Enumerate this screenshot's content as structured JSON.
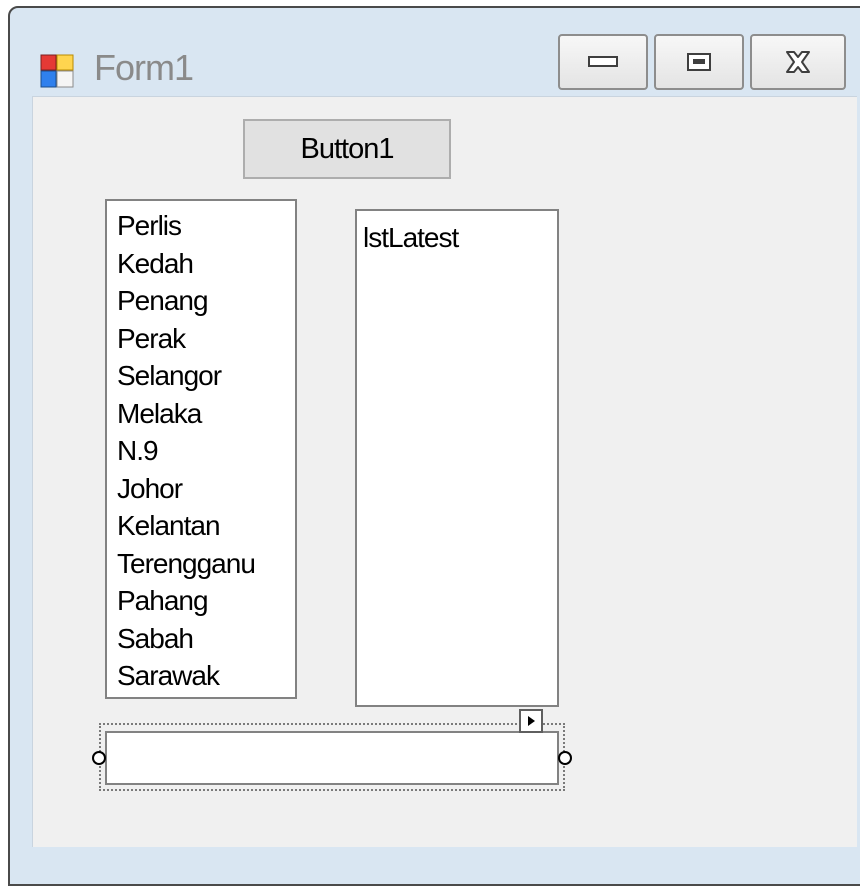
{
  "window": {
    "title": "Form1",
    "controls": {
      "minimize_icon": "minimize-icon",
      "maximize_icon": "maximize-icon",
      "close_icon": "close-icon"
    }
  },
  "form": {
    "button1_label": "Button1",
    "states_list": [
      "Perlis",
      "Kedah",
      "Penang",
      "Perak",
      "Selangor",
      "Melaka",
      "N.9",
      "Johor",
      "Kelantan",
      "Terengganu",
      "Pahang",
      "Sabah",
      "Sarawak"
    ],
    "latest_list": [
      "lstLatest"
    ],
    "textbox_value": ""
  },
  "designer": {
    "smart_tag_icon": "smart-tag-arrow-icon",
    "selected_control": "textbox"
  },
  "colors": {
    "window_frame": "#d9e6f2",
    "client_background": "#f0f0f0",
    "button_background": "#e1e1e1",
    "list_background": "#ffffff",
    "border": "#828282"
  }
}
